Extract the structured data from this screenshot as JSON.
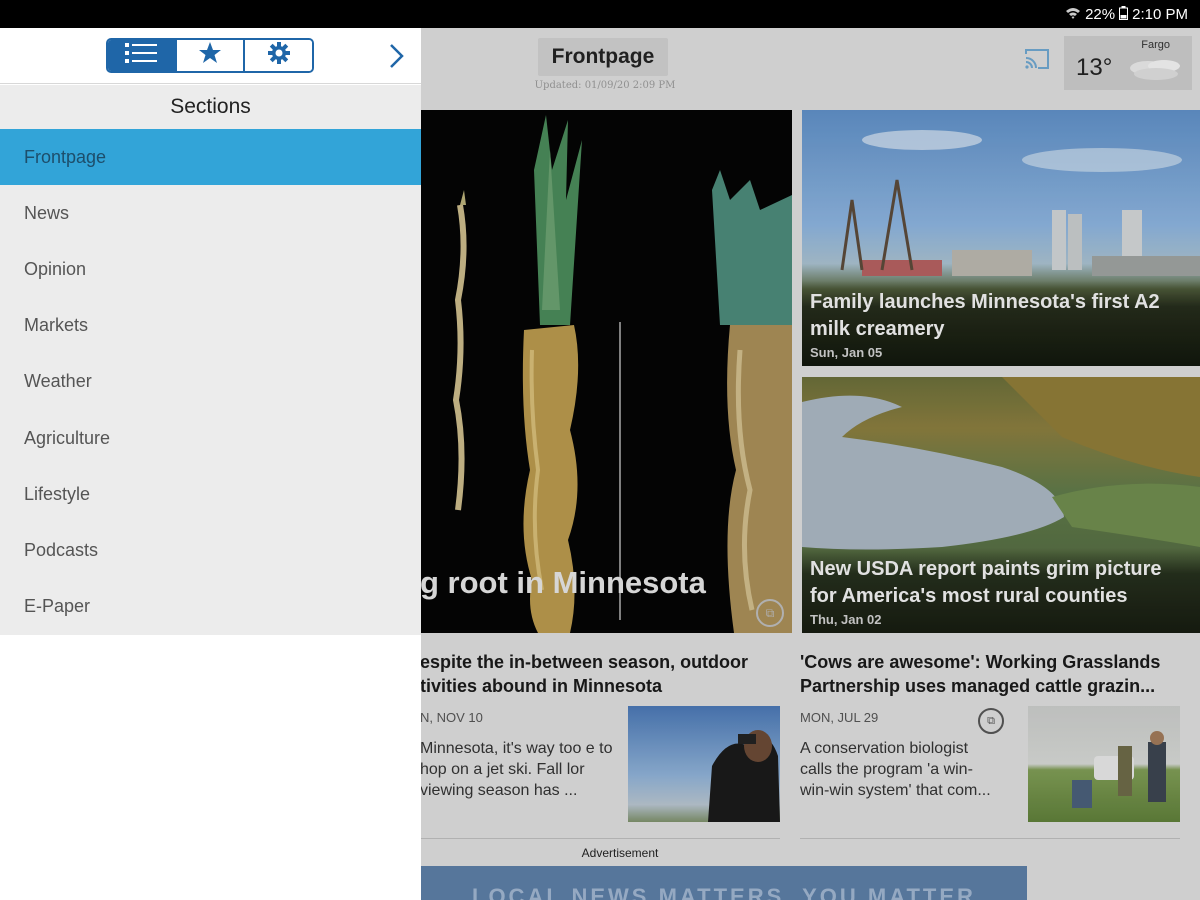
{
  "status_bar": {
    "battery": "22%",
    "time": "2:10 PM"
  },
  "header": {
    "title": "Frontpage",
    "updated": "Updated: 01/09/20 2:09 PM",
    "weather": {
      "city": "Fargo",
      "temp": "13°"
    }
  },
  "drawer": {
    "tabs": [
      {
        "icon": "list-icon",
        "active": true
      },
      {
        "icon": "star-icon",
        "active": false
      },
      {
        "icon": "gear-icon",
        "active": false
      }
    ],
    "sections_title": "Sections",
    "items": [
      {
        "label": "Frontpage",
        "active": true
      },
      {
        "label": "News"
      },
      {
        "label": "Opinion"
      },
      {
        "label": "Markets"
      },
      {
        "label": "Weather"
      },
      {
        "label": "Agriculture"
      },
      {
        "label": "Lifestyle"
      },
      {
        "label": "Podcasts"
      },
      {
        "label": "E-Paper"
      }
    ]
  },
  "hero": {
    "title": "g root in Minnesota"
  },
  "cards": [
    {
      "title": "Family launches Minnesota's first A2 milk creamery",
      "date": "Sun, Jan 05"
    },
    {
      "title": "New USDA report paints grim picture for America's most rural counties",
      "date": "Thu, Jan 02"
    }
  ],
  "stories": [
    {
      "title_line1": "espite the in-between season, outdoor",
      "title_line2": "tivities abound in Minnesota",
      "date": "N, NOV 10",
      "snippet": "Minnesota, it's way too e to hop on a jet ski. Fall lor viewing season has ..."
    },
    {
      "title_line1": "'Cows are awesome': Working Grasslands",
      "title_line2": "Partnership uses managed cattle grazin...",
      "date": "MON, JUL 29",
      "snippet": "A conservation biologist calls the program 'a win-win-win system' that com..."
    }
  ],
  "ad": {
    "label": "Advertisement",
    "banner_text": "LOCAL NEWS MATTERS. YOU MATTER."
  },
  "colors": {
    "accent": "#1f66a8",
    "active_item": "#32a4d8",
    "drawer_bg": "#ececec"
  }
}
